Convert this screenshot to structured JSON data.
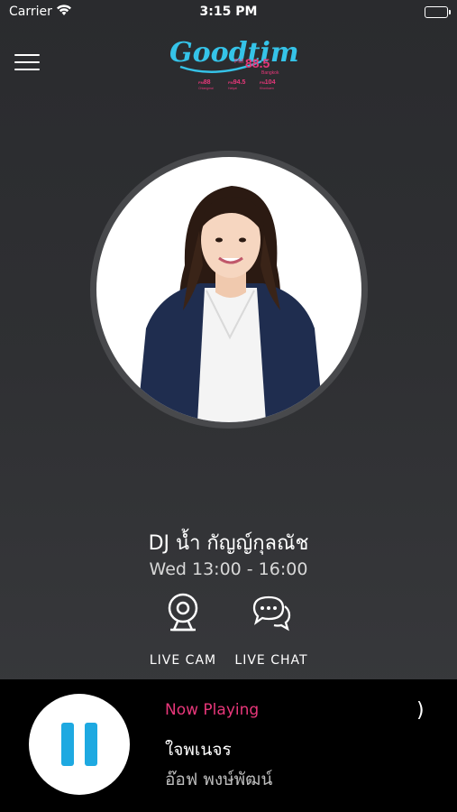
{
  "status_bar": {
    "carrier": "Carrier",
    "time": "3:15 PM"
  },
  "header": {
    "logo": {
      "brand": "Goodtime",
      "main_frequency": "88.5",
      "main_prefix": "FM",
      "main_city": "Bangkok",
      "sub_stations": [
        {
          "prefix": "FM",
          "frequency": "88",
          "city": "Chiangmai"
        },
        {
          "prefix": "FM",
          "frequency": "94.5",
          "city": "Hatyai"
        },
        {
          "prefix": "FM",
          "frequency": "104",
          "city": "Khonkaen"
        }
      ]
    }
  },
  "dj": {
    "name": "DJ น้ำ กัญญ์กุลณัช",
    "schedule": "Wed 13:00 - 16:00"
  },
  "actions": {
    "live_cam_label": "LIVE CAM",
    "live_chat_label": "LIVE CHAT"
  },
  "player": {
    "now_playing_label": "Now Playing",
    "song_title": "ใจพเนจร",
    "artist": "อ๊อฟ พงษ์พัฒน์",
    "state": "playing",
    "expand_glyph": ")"
  },
  "colors": {
    "accent_blue": "#1ea9e1",
    "accent_pink": "#e8377a",
    "background": "#2f3033",
    "player_background": "#000000"
  }
}
